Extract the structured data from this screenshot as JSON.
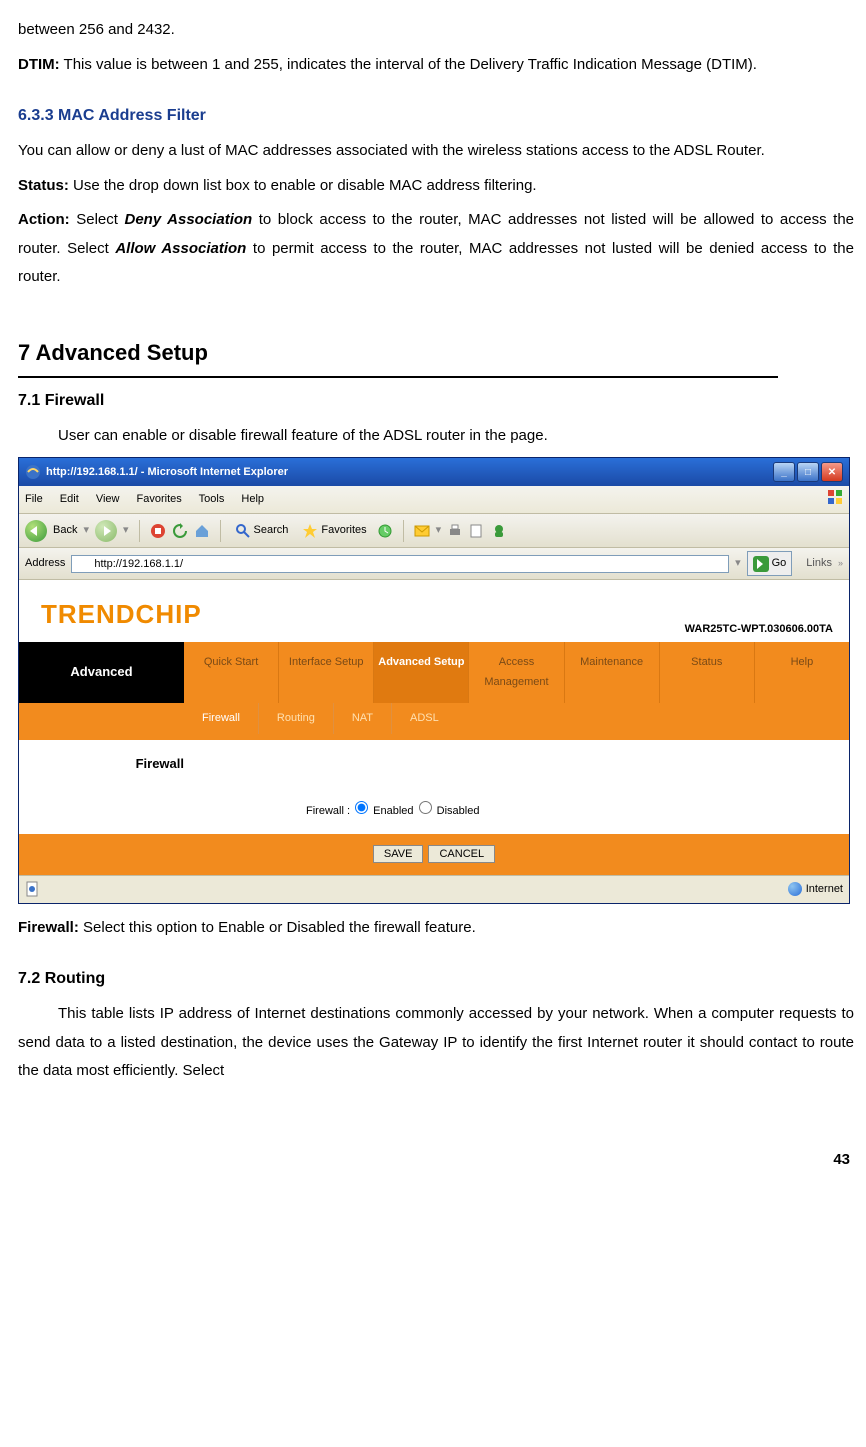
{
  "text": {
    "line1": "between 256 and 2432.",
    "dtim_label": "DTIM:",
    "dtim_body": " This value is between 1 and 255, indicates the interval of the Delivery Traffic Indication Message (DTIM).",
    "sec633": "6.3.3 MAC Address Filter",
    "mac_intro": "You can allow or deny a lust of MAC addresses associated with the wireless stations access to the ADSL Router.",
    "status_label": "Status:",
    "status_body": " Use the drop down list box to enable or disable MAC address filtering.",
    "action_label": "Action:",
    "action_body1": " Select ",
    "action_deny": "Deny Association",
    "action_body2": " to block access to the router, MAC addresses not listed will be allowed to access the router. Select ",
    "action_allow": "Allow Association",
    "action_body3": " to permit access to the router, MAC addresses not lusted will be denied access to the router.",
    "h1": "7 Advanced Setup",
    "sec71": "7.1 Firewall",
    "firewall_intro": "User can enable or disable firewall feature of the ADSL router in the page.",
    "firewall_label": "Firewall:",
    "firewall_body": " Select this option to Enable or Disabled the firewall feature.",
    "sec72": "7.2 Routing",
    "routing_body": "This table lists IP address of Internet destinations commonly accessed by your network. When a computer requests to send data to a listed destination, the device uses the Gateway IP to identify the first Internet router it should contact to route the data most efficiently. Select",
    "pagenum": "43"
  },
  "ie": {
    "title": "http://192.168.1.1/ - Microsoft Internet Explorer",
    "menus": [
      "File",
      "Edit",
      "View",
      "Favorites",
      "Tools",
      "Help"
    ],
    "back": "Back",
    "search": "Search",
    "favorites": "Favorites",
    "address_label": "Address",
    "address_value": "http://192.168.1.1/",
    "go": "Go",
    "links": "Links",
    "status_right": "Internet"
  },
  "router": {
    "brand": "TRENDCHIP",
    "version": "WAR25TC-WPT.030606.00TA",
    "left_tab": "Advanced",
    "main_tabs": [
      "Quick Start",
      "Interface Setup",
      "Advanced Setup",
      "Access Management",
      "Maintenance",
      "Status",
      "Help"
    ],
    "main_active_index": 2,
    "sub_tabs": [
      "Firewall",
      "Routing",
      "NAT",
      "ADSL"
    ],
    "sub_active_index": 0,
    "section_label": "Firewall",
    "fw_field_label": "Firewall :",
    "fw_enabled": "Enabled",
    "fw_disabled": "Disabled",
    "save": "SAVE",
    "cancel": "CANCEL"
  }
}
